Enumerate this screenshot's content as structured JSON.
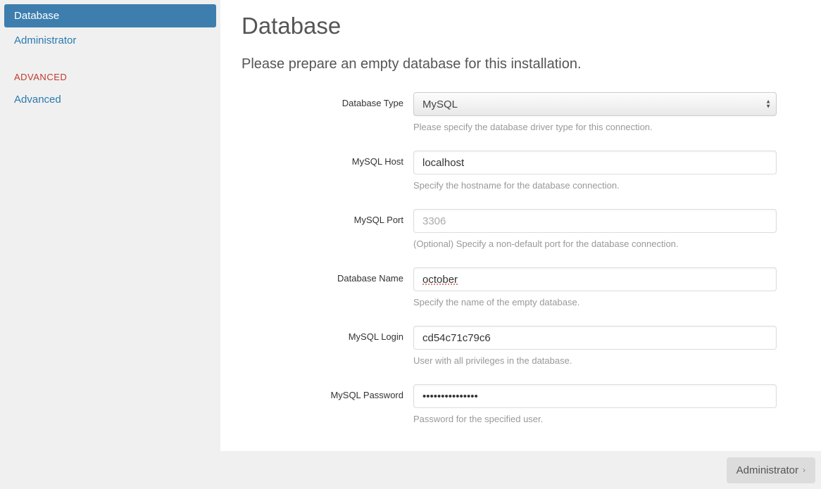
{
  "sidebar": {
    "items": [
      {
        "label": "Database",
        "active": true
      },
      {
        "label": "Administrator",
        "active": false
      }
    ],
    "advanced_heading": "ADVANCED",
    "advanced_items": [
      {
        "label": "Advanced",
        "active": false
      }
    ]
  },
  "page": {
    "title": "Database",
    "subtitle": "Please prepare an empty database for this installation."
  },
  "form": {
    "db_type": {
      "label": "Database Type",
      "value": "MySQL",
      "help": "Please specify the database driver type for this connection."
    },
    "host": {
      "label": "MySQL Host",
      "value": "localhost",
      "help": "Specify the hostname for the database connection."
    },
    "port": {
      "label": "MySQL Port",
      "placeholder": "3306",
      "value": "",
      "help": "(Optional) Specify a non-default port for the database connection."
    },
    "dbname": {
      "label": "Database Name",
      "value": "october",
      "help": "Specify the name of the empty database."
    },
    "login": {
      "label": "MySQL Login",
      "value": "cd54c71c79c6",
      "help": "User with all privileges in the database."
    },
    "password": {
      "label": "MySQL Password",
      "value": "•••••••••••••••",
      "help": "Password for the specified user."
    }
  },
  "footer": {
    "next_label": "Administrator"
  }
}
